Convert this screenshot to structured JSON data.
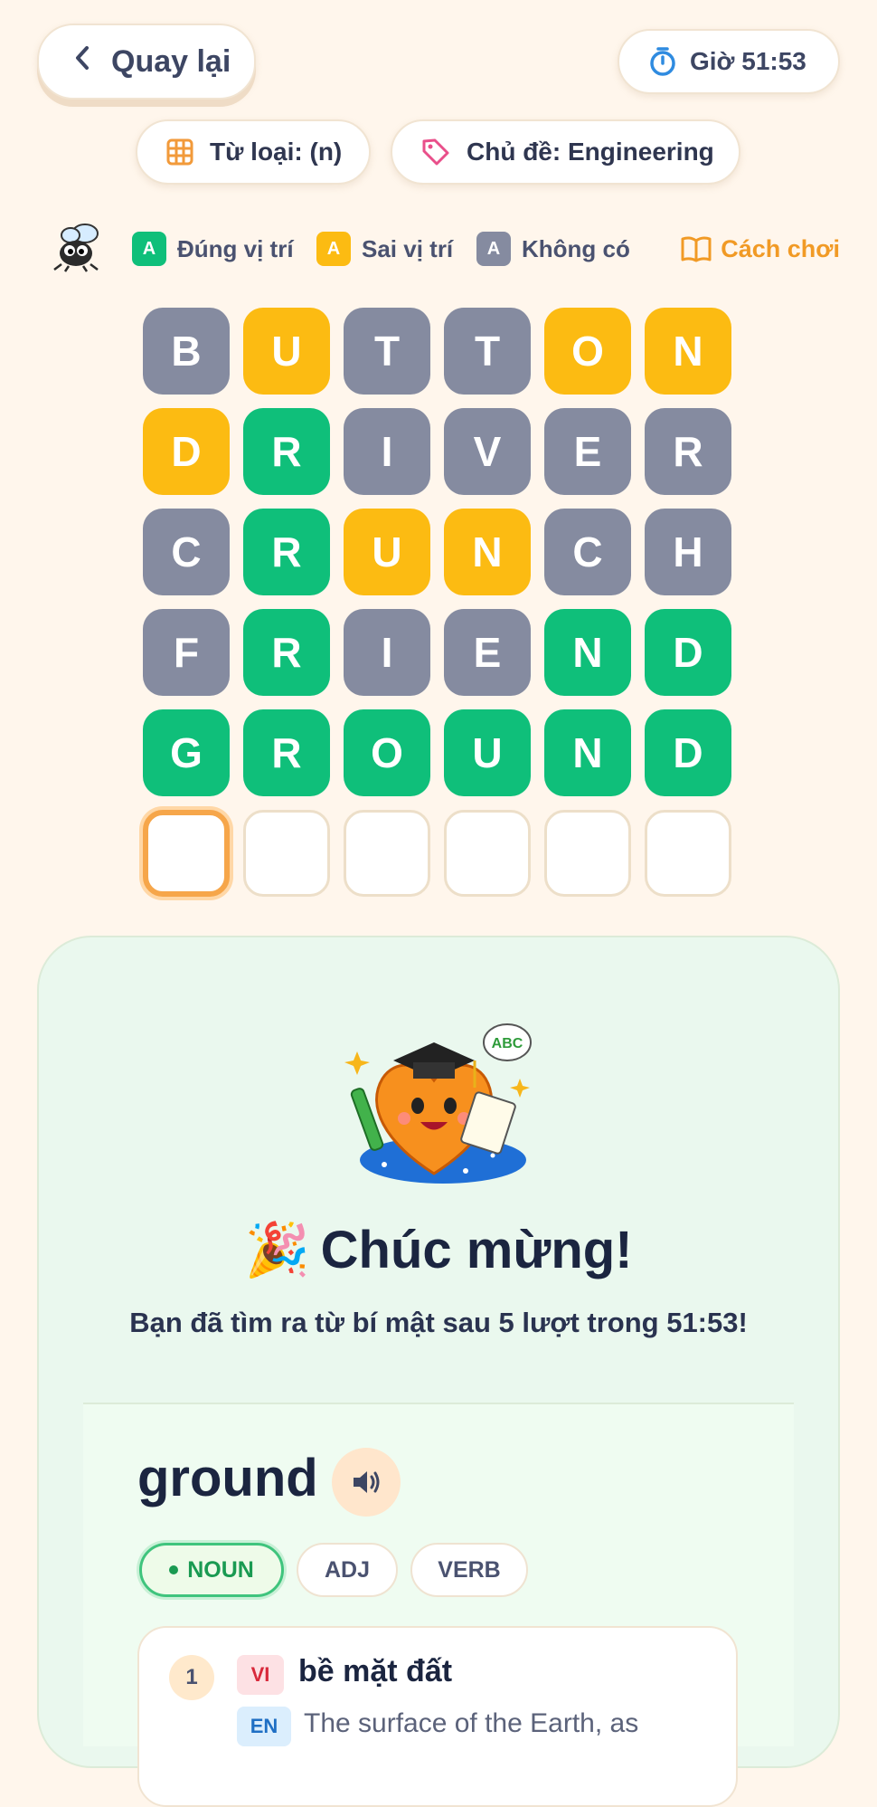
{
  "header": {
    "back_label": "Quay lại",
    "timer_label": "Giờ 51:53"
  },
  "filters": {
    "word_type": "Từ loại: (n)",
    "topic": "Chủ đề: Engineering"
  },
  "legend": {
    "sample_letter": "A",
    "correct": "Đúng vị trí",
    "misplaced": "Sai vị trí",
    "absent": "Không có",
    "how_to_play": "Cách chơi"
  },
  "colors": {
    "correct": "#0fbf7a",
    "misplaced": "#fcbb12",
    "absent": "#858ba0",
    "accent": "#f19a25"
  },
  "board": {
    "rows": [
      [
        "B",
        "U",
        "T",
        "T",
        "O",
        "N"
      ],
      [
        "D",
        "R",
        "I",
        "V",
        "E",
        "R"
      ],
      [
        "C",
        "R",
        "U",
        "N",
        "C",
        "H"
      ],
      [
        "F",
        "R",
        "I",
        "E",
        "N",
        "D"
      ],
      [
        "G",
        "R",
        "O",
        "U",
        "N",
        "D"
      ],
      [
        "",
        "",
        "",
        "",
        "",
        ""
      ]
    ],
    "states": [
      [
        "x",
        "y",
        "x",
        "x",
        "y",
        "y"
      ],
      [
        "y",
        "g",
        "x",
        "x",
        "x",
        "x"
      ],
      [
        "x",
        "g",
        "y",
        "y",
        "x",
        "x"
      ],
      [
        "x",
        "g",
        "x",
        "x",
        "g",
        "g"
      ],
      [
        "g",
        "g",
        "g",
        "g",
        "g",
        "g"
      ],
      [
        "e",
        "e",
        "e",
        "e",
        "e",
        "e"
      ]
    ]
  },
  "result": {
    "title": "Chúc mừng!",
    "title_emoji": "🎉",
    "message": "Bạn đã tìm ra từ bí mật sau 5 lượt trong 51:53!",
    "mascot_bubble": "ABC"
  },
  "definition": {
    "word": "ground",
    "parts_of_speech": [
      "NOUN",
      "ADJ",
      "VERB"
    ],
    "selected_pos": "NOUN",
    "entry_number": "1",
    "vi_tag": "VI",
    "vi_text": "bề mặt đất",
    "en_tag": "EN",
    "en_text": "The surface of the Earth, as"
  }
}
